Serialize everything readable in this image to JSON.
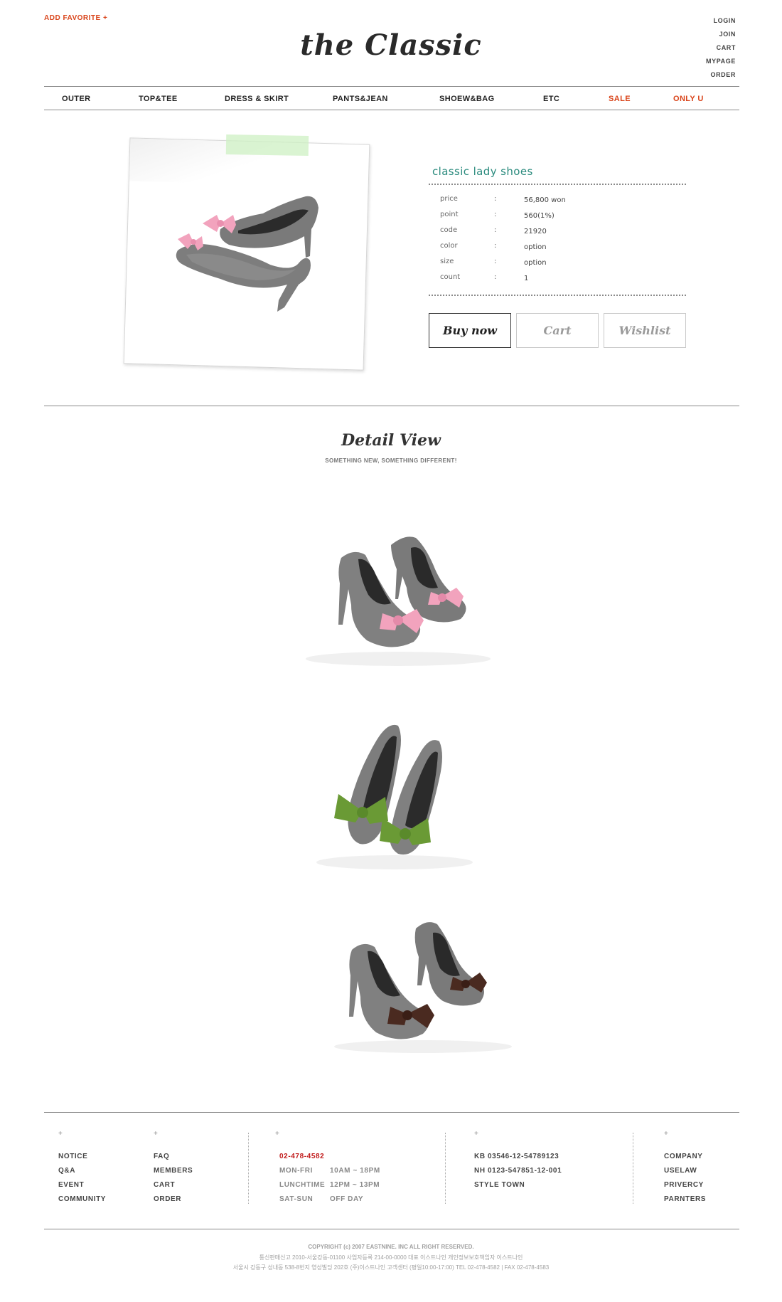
{
  "header": {
    "add_favorite": "ADD FAVORITE +",
    "logo": "the Classic",
    "util_links": [
      "LOGIN",
      "JOIN",
      "CART",
      "MYPAGE",
      "ORDER"
    ]
  },
  "nav": {
    "items": [
      "OUTER",
      "TOP&TEE",
      "DRESS & SKIRT",
      "PANTS&JEAN",
      "SHOEW&BAG",
      "ETC",
      "SALE",
      "ONLY U"
    ]
  },
  "product": {
    "name": "classic lady shoes",
    "specs": [
      {
        "label": "price",
        "sep": ":",
        "value": "56,800 won"
      },
      {
        "label": "point",
        "sep": ":",
        "value": "560(1%)"
      },
      {
        "label": "code",
        "sep": ":",
        "value": "21920"
      },
      {
        "label": "color",
        "sep": ":",
        "value": "option"
      },
      {
        "label": "size",
        "sep": ":",
        "value": "option"
      },
      {
        "label": "count",
        "sep": ":",
        "value": "1"
      }
    ],
    "buttons": {
      "buy": "Buy now",
      "cart": "Cart",
      "wishlist": "Wishlist"
    }
  },
  "detail": {
    "title": "Detail View",
    "subtitle": "SOMETHING NEW, SOMETHING DIFFERENT!"
  },
  "colors": {
    "accent_red": "#d9441a",
    "product_name": "#2b8b7e",
    "phone_red": "#c11a1a",
    "bow_pink": "#f2a3bd",
    "bow_green": "#6a9a35",
    "bow_brown": "#4a2a20",
    "shoe_gray": "#7a7a7a"
  },
  "footer": {
    "plus": "+",
    "col1": [
      "NOTICE",
      "Q&A",
      "EVENT",
      "COMMUNITY"
    ],
    "col2": [
      "FAQ",
      "MEMBERS",
      "CART",
      "ORDER"
    ],
    "phone": "02-478-4582",
    "hours": [
      {
        "label": "MON-FRI",
        "value": "10AM ~ 18PM"
      },
      {
        "label": "LUNCHTIME",
        "value": "12PM ~ 13PM"
      },
      {
        "label": "SAT-SUN",
        "value": "OFF DAY"
      }
    ],
    "bank": [
      "KB 03546-12-54789123",
      "NH 0123-547851-12-001",
      "STYLE TOWN"
    ],
    "col5": [
      "COMPANY",
      "USELAW",
      "PRIVERCY",
      "PARNTERS"
    ],
    "copyright": "COPYRIGHT (c) 2007 EASTNINE. INC ALL RIGHT RESERVED.",
    "business": "통신판매신고 2010-서울강동-01100      사업자등록 214-00-0000   대표 이스트나인   개인정보보호책임자 이스트나인",
    "address": "서울시 강동구 성내동 538-8번지 영성빌딩 202호 (주)이스트나인  고객센터 (평일10:00-17:00)  TEL 02-478-4582  |  FAX 02-478-4583"
  }
}
